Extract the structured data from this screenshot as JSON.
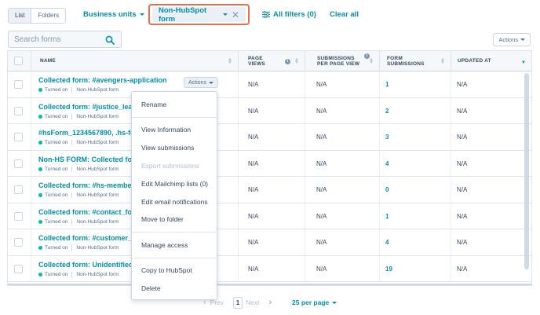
{
  "view_toggle": {
    "list": "List",
    "folders": "Folders"
  },
  "filters": {
    "business_units": "Business units",
    "form_type": "Non-HubSpot form",
    "all_filters": "All filters (0)",
    "clear_all": "Clear all"
  },
  "search": {
    "placeholder": "Search forms"
  },
  "actions_label": "Actions",
  "columns": {
    "name": "NAME",
    "page_views": "PAGE VIEWS",
    "submissions_per_view": "SUBMISSIONS PER PAGE VIEW",
    "form_submissions": "FORM SUBMISSIONS",
    "updated_at": "UPDATED AT"
  },
  "rows": [
    {
      "name": "Collected form: #avengers-application",
      "status": "Turned on",
      "type": "Non-HubSpot form",
      "page_views": "N/A",
      "spv": "N/A",
      "submissions": "1",
      "updated": "N/A"
    },
    {
      "name": "Collected form: #justice_league",
      "status": "Turned on",
      "type": "Non-HubSpot form",
      "page_views": "N/A",
      "spv": "N/A",
      "submissions": "2",
      "updated": "N/A"
    },
    {
      "name": "#hsForm_1234567890, .hs-form",
      "status": "Turned on",
      "type": "Non-HubSpot form",
      "page_views": "N/A",
      "spv": "N/A",
      "submissions": "3",
      "updated": "N/A"
    },
    {
      "name": "Non-HS FORM: Collected form",
      "status": "Turned on",
      "type": "Non-HubSpot form",
      "page_views": "N/A",
      "spv": "N/A",
      "submissions": "4",
      "updated": "N/A"
    },
    {
      "name": "Collected form: #hs-members",
      "status": "Turned on",
      "type": "Non-HubSpot form",
      "page_views": "N/A",
      "spv": "N/A",
      "submissions": "0",
      "updated": "N/A"
    },
    {
      "name": "Collected form: #contact_form",
      "status": "Turned on",
      "type": "Non-HubSpot form",
      "page_views": "N/A",
      "spv": "N/A",
      "submissions": "1",
      "updated": "N/A"
    },
    {
      "name": "Collected form: #customer_login",
      "status": "Turned on",
      "type": "Non-HubSpot form",
      "page_views": "N/A",
      "spv": "N/A",
      "submissions": "4",
      "updated": "N/A"
    },
    {
      "name": "Collected form: Unidentified Form",
      "status": "Turned on",
      "type": "Non-HubSpot form",
      "page_views": "N/A",
      "spv": "N/A",
      "submissions": "19",
      "updated": "N/A"
    }
  ],
  "menu": {
    "rename": "Rename",
    "view_information": "View Information",
    "view_submissions": "View submissions",
    "export_submissions": "Export submissions",
    "edit_mailchimp": "Edit Mailchimp lists (0)",
    "edit_email": "Edit email notifications",
    "move_folder": "Move to folder",
    "manage_access": "Manage access",
    "copy_hubspot": "Copy to HubSpot",
    "delete": "Delete"
  },
  "pagination": {
    "prev": "Prev",
    "page": "1",
    "next": "Next",
    "per_page": "25 per page"
  },
  "colors": {
    "accent": "#0091ae",
    "status_on": "#00bda5",
    "highlight": "#e5714a"
  },
  "icons": [
    "search-icon",
    "close-icon",
    "filter-icon",
    "chevron-down-icon",
    "info-icon",
    "sort-icon",
    "chevron-left-icon",
    "chevron-right-icon"
  ]
}
